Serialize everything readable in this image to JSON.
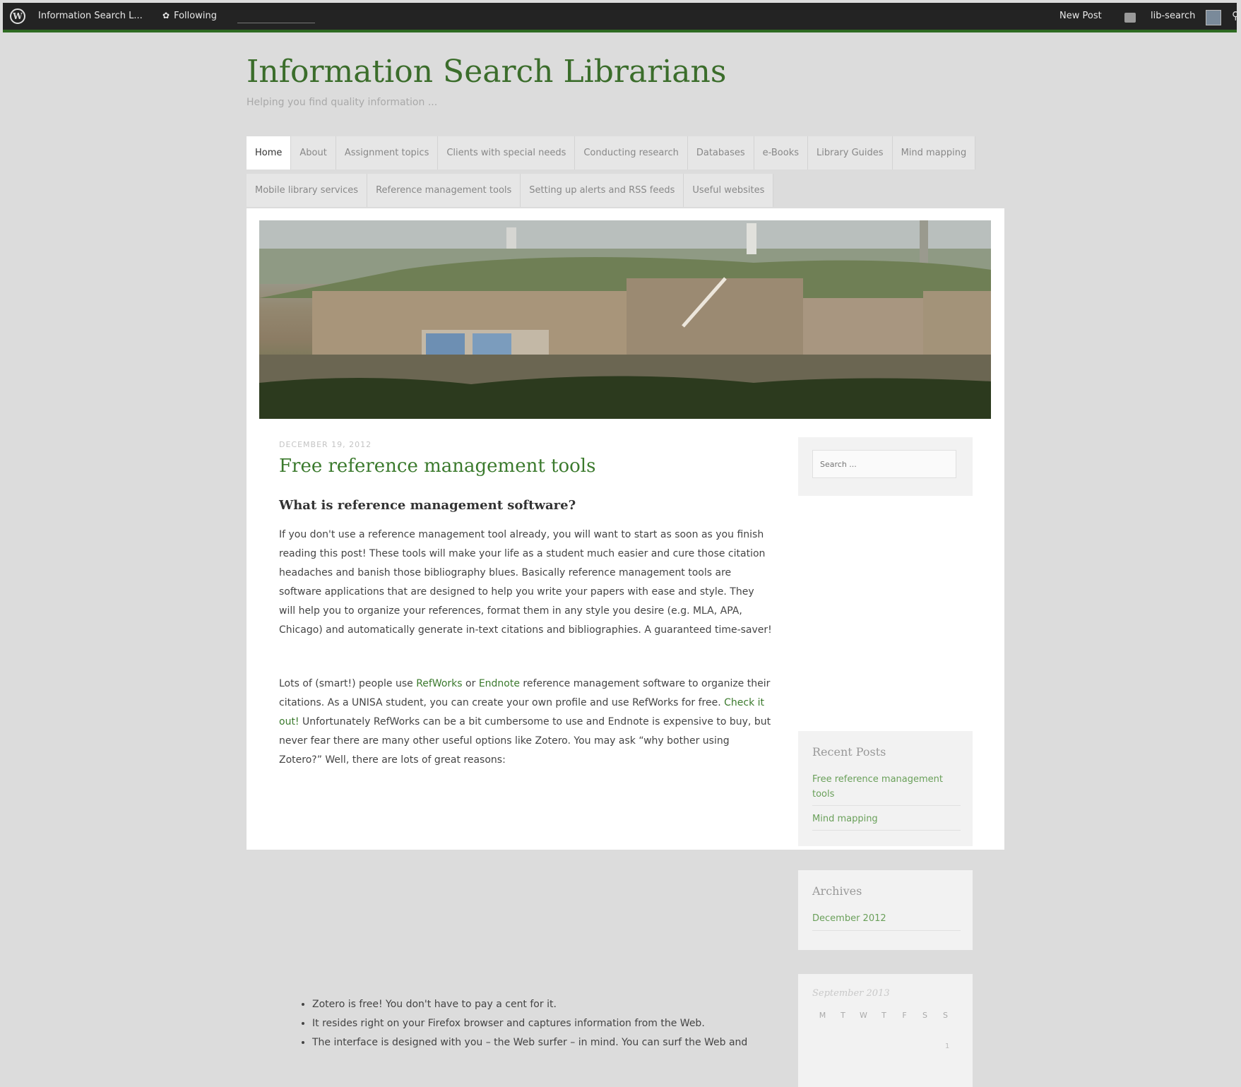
{
  "adminbar": {
    "wp_logo": "W",
    "site_name": "Information Search L...",
    "following_icon": "gear-icon",
    "following_label": "Following",
    "new_post_label": "New Post",
    "user_label": "lib-search",
    "search_icon": "search-icon"
  },
  "site": {
    "title": "Information Search Librarians",
    "description": "Helping you find quality information ..."
  },
  "nav": {
    "row1": [
      "Home",
      "About",
      "Assignment topics",
      "Clients with special needs",
      "Conducting research",
      "Databases",
      "e-Books",
      "Library Guides",
      "Mind mapping"
    ],
    "row2": [
      "Mobile library services",
      "Reference management tools",
      "Setting up alerts and RSS feeds",
      "Useful websites"
    ],
    "active": "Home"
  },
  "post": {
    "date": "DECEMBER 19, 2012",
    "title": "Free reference management tools",
    "subtitle": "What is reference management software?",
    "para1": "If you don't use a reference management tool already, you will want to start as soon as you finish reading this post! These tools will make your life as a student much easier and cure those citation headaches and banish those bibliography blues. Basically reference management tools are software applications that are designed to help you write your papers with ease and style. They will help you to organize your references, format them in any style you desire (e.g. MLA, APA, Chicago) and automatically generate in-text citations and bibliographies. A guaranteed time-saver!",
    "para2": {
      "part1": "Lots of (smart!) people use ",
      "link_refworks": "RefWorks",
      "part2": " or ",
      "link_endnote": "Endnote",
      "part3": " reference management software to organize their citations. As a UNISA student, you can create your own profile and use RefWorks for free. ",
      "link_check": "Check it out!",
      "part4": " Unfortunately RefWorks can be a bit cumbersome to use and Endnote is expensive to buy, but never fear there are many other useful options like Zotero. You may ask “why bother using Zotero?” Well, there are lots of great reasons:"
    },
    "bullets": [
      "Zotero is free! You don't have to pay a cent for it.",
      "It resides right on your Firefox browser and captures information from the Web.",
      "The interface is designed with you – the Web surfer – in mind. You can surf the Web and"
    ]
  },
  "sidebar": {
    "search_placeholder": "Search ...",
    "recent_title": "Recent Posts",
    "recent_posts": [
      "Free reference management tools",
      "Mind mapping"
    ],
    "archives_title": "Archives",
    "archives": [
      "December 2012"
    ],
    "calendar_caption": "September 2013",
    "calendar_days": [
      "M",
      "T",
      "W",
      "T",
      "F",
      "S",
      "S"
    ],
    "calendar_first_day": "1"
  },
  "colors": {
    "accent_green": "#3b7a2d",
    "adminbar_bg": "#232323",
    "page_bg": "#dcdcdc"
  }
}
